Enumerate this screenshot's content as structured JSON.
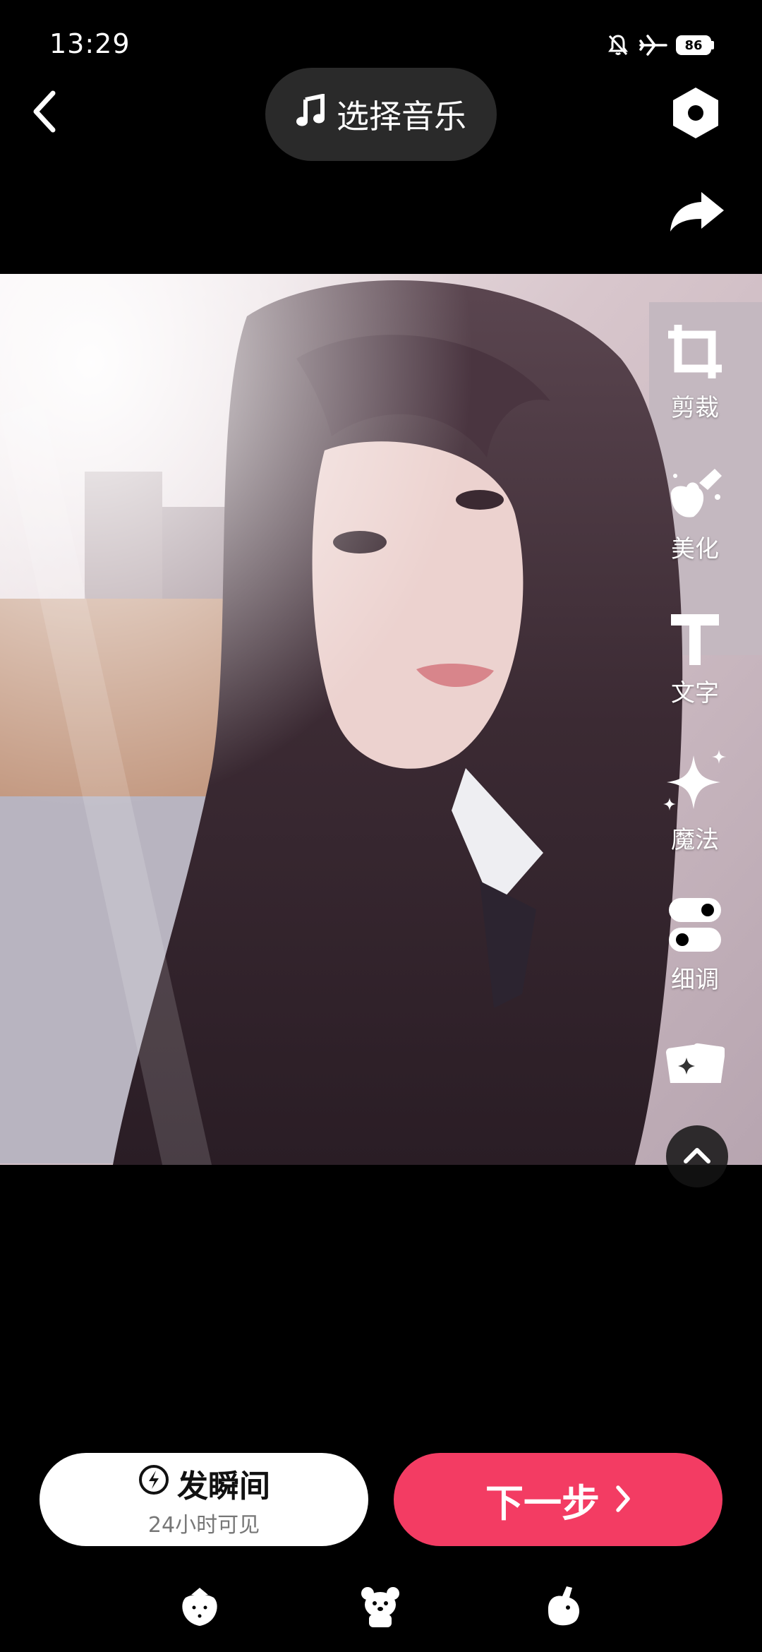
{
  "status_bar": {
    "time": "13:29",
    "battery": "86",
    "icons": [
      "bell-off-icon",
      "airplane-icon",
      "battery-icon"
    ]
  },
  "top_bar": {
    "back_icon": "chevron-left-icon",
    "music_label": "选择音乐",
    "music_icon": "music-note-icon",
    "settings_icon": "hexagon-settings-icon",
    "share_icon": "share-arrow-icon"
  },
  "tools": [
    {
      "label": "剪裁",
      "icon": "crop-icon"
    },
    {
      "label": "美化",
      "icon": "beauty-icon"
    },
    {
      "label": "文字",
      "icon": "text-icon"
    },
    {
      "label": "魔法",
      "icon": "sparkle-icon"
    },
    {
      "label": "细调",
      "icon": "toggle-icon"
    }
  ],
  "extra_tool_icon": "sticker-cards-icon",
  "expand_icon": "chevron-up-icon",
  "bottom": {
    "moment_label": "发瞬间",
    "moment_sub": "24小时可见",
    "next_label": "下一步",
    "accent": "#f33c63"
  },
  "bottom_icons": [
    "strawberry-icon",
    "bear-icon",
    "bunny-icon"
  ]
}
